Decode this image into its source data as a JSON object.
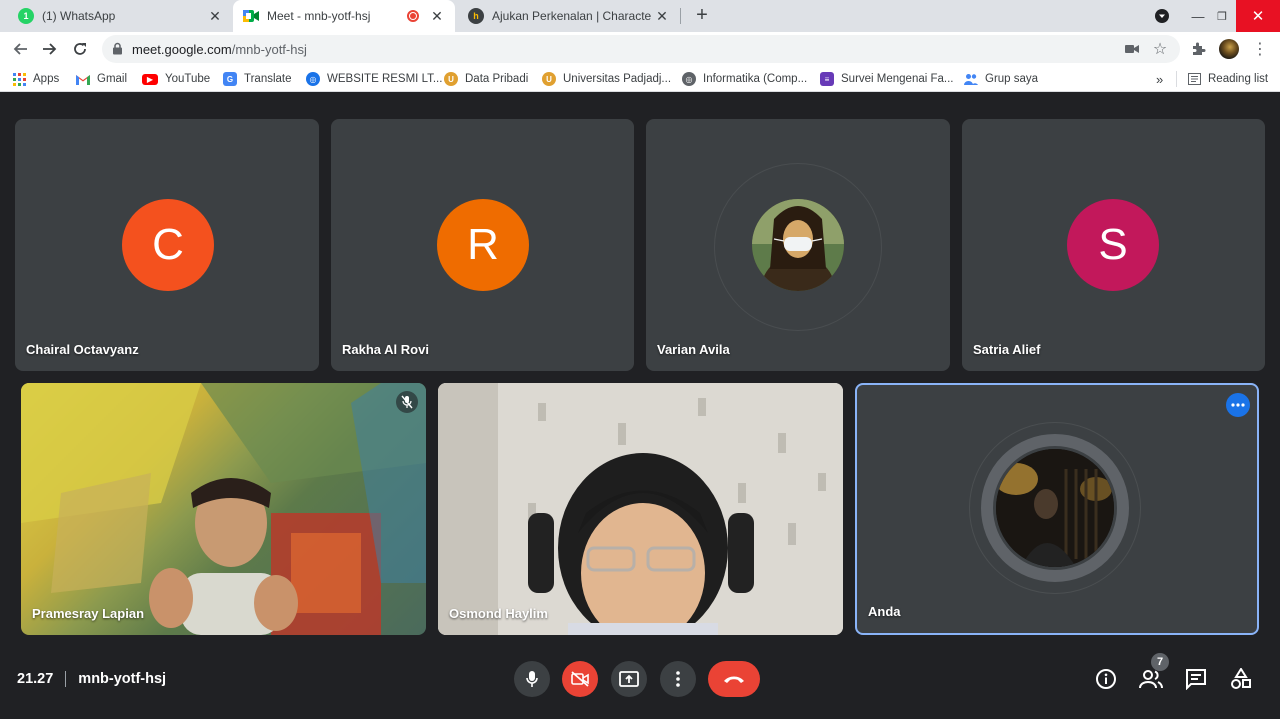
{
  "browser": {
    "tabs": [
      {
        "title": "(1) WhatsApp",
        "favicon": "whatsapp-icon",
        "active": false
      },
      {
        "title": "Meet - mnb-yotf-hsj",
        "favicon": "meet-icon",
        "active": true,
        "recording": true
      },
      {
        "title": "Ajukan Perkenalan | Character Bu",
        "favicon": "site-icon",
        "active": false
      }
    ],
    "url_host": "meet.google.com",
    "url_path": "/mnb-yotf-hsj",
    "bookmarks": [
      {
        "label": "Apps",
        "icon": "apps-grid-icon"
      },
      {
        "label": "Gmail",
        "icon": "gmail-icon"
      },
      {
        "label": "YouTube",
        "icon": "youtube-icon"
      },
      {
        "label": "Translate",
        "icon": "translate-icon"
      },
      {
        "label": "WEBSITE RESMI LT...",
        "icon": "globe-icon"
      },
      {
        "label": "Data Pribadi",
        "icon": "university-icon"
      },
      {
        "label": "Universitas Padjadj...",
        "icon": "university-icon"
      },
      {
        "label": "Informatika (Comp...",
        "icon": "globe-icon"
      },
      {
        "label": "Survei Mengenai Fa...",
        "icon": "forms-icon"
      },
      {
        "label": "Grup saya",
        "icon": "groups-icon"
      }
    ],
    "reading_list": "Reading list"
  },
  "meet": {
    "top_row": [
      {
        "name": "Chairal Octavyanz",
        "initial": "C",
        "avatar_color": "#f4511e"
      },
      {
        "name": "Rakha Al Rovi",
        "initial": "R",
        "avatar_color": "#ef6c00"
      },
      {
        "name": "Varian Avila",
        "initial": "",
        "avatar_color": "#6d5a2e"
      },
      {
        "name": "Satria Alief",
        "initial": "S",
        "avatar_color": "#c2185b"
      }
    ],
    "bottom_row": [
      {
        "name": "Pramesray Lapian",
        "muted": true
      },
      {
        "name": "Osmond Haylim",
        "muted": false
      },
      {
        "name": "Anda",
        "self": true
      }
    ],
    "time": "21.27",
    "meeting_code": "mnb-yotf-hsj",
    "participant_count": "7"
  },
  "colors": {
    "accent": "#8ab4f8",
    "danger": "#ea4335",
    "tile": "#3c4043",
    "background": "#202124"
  }
}
